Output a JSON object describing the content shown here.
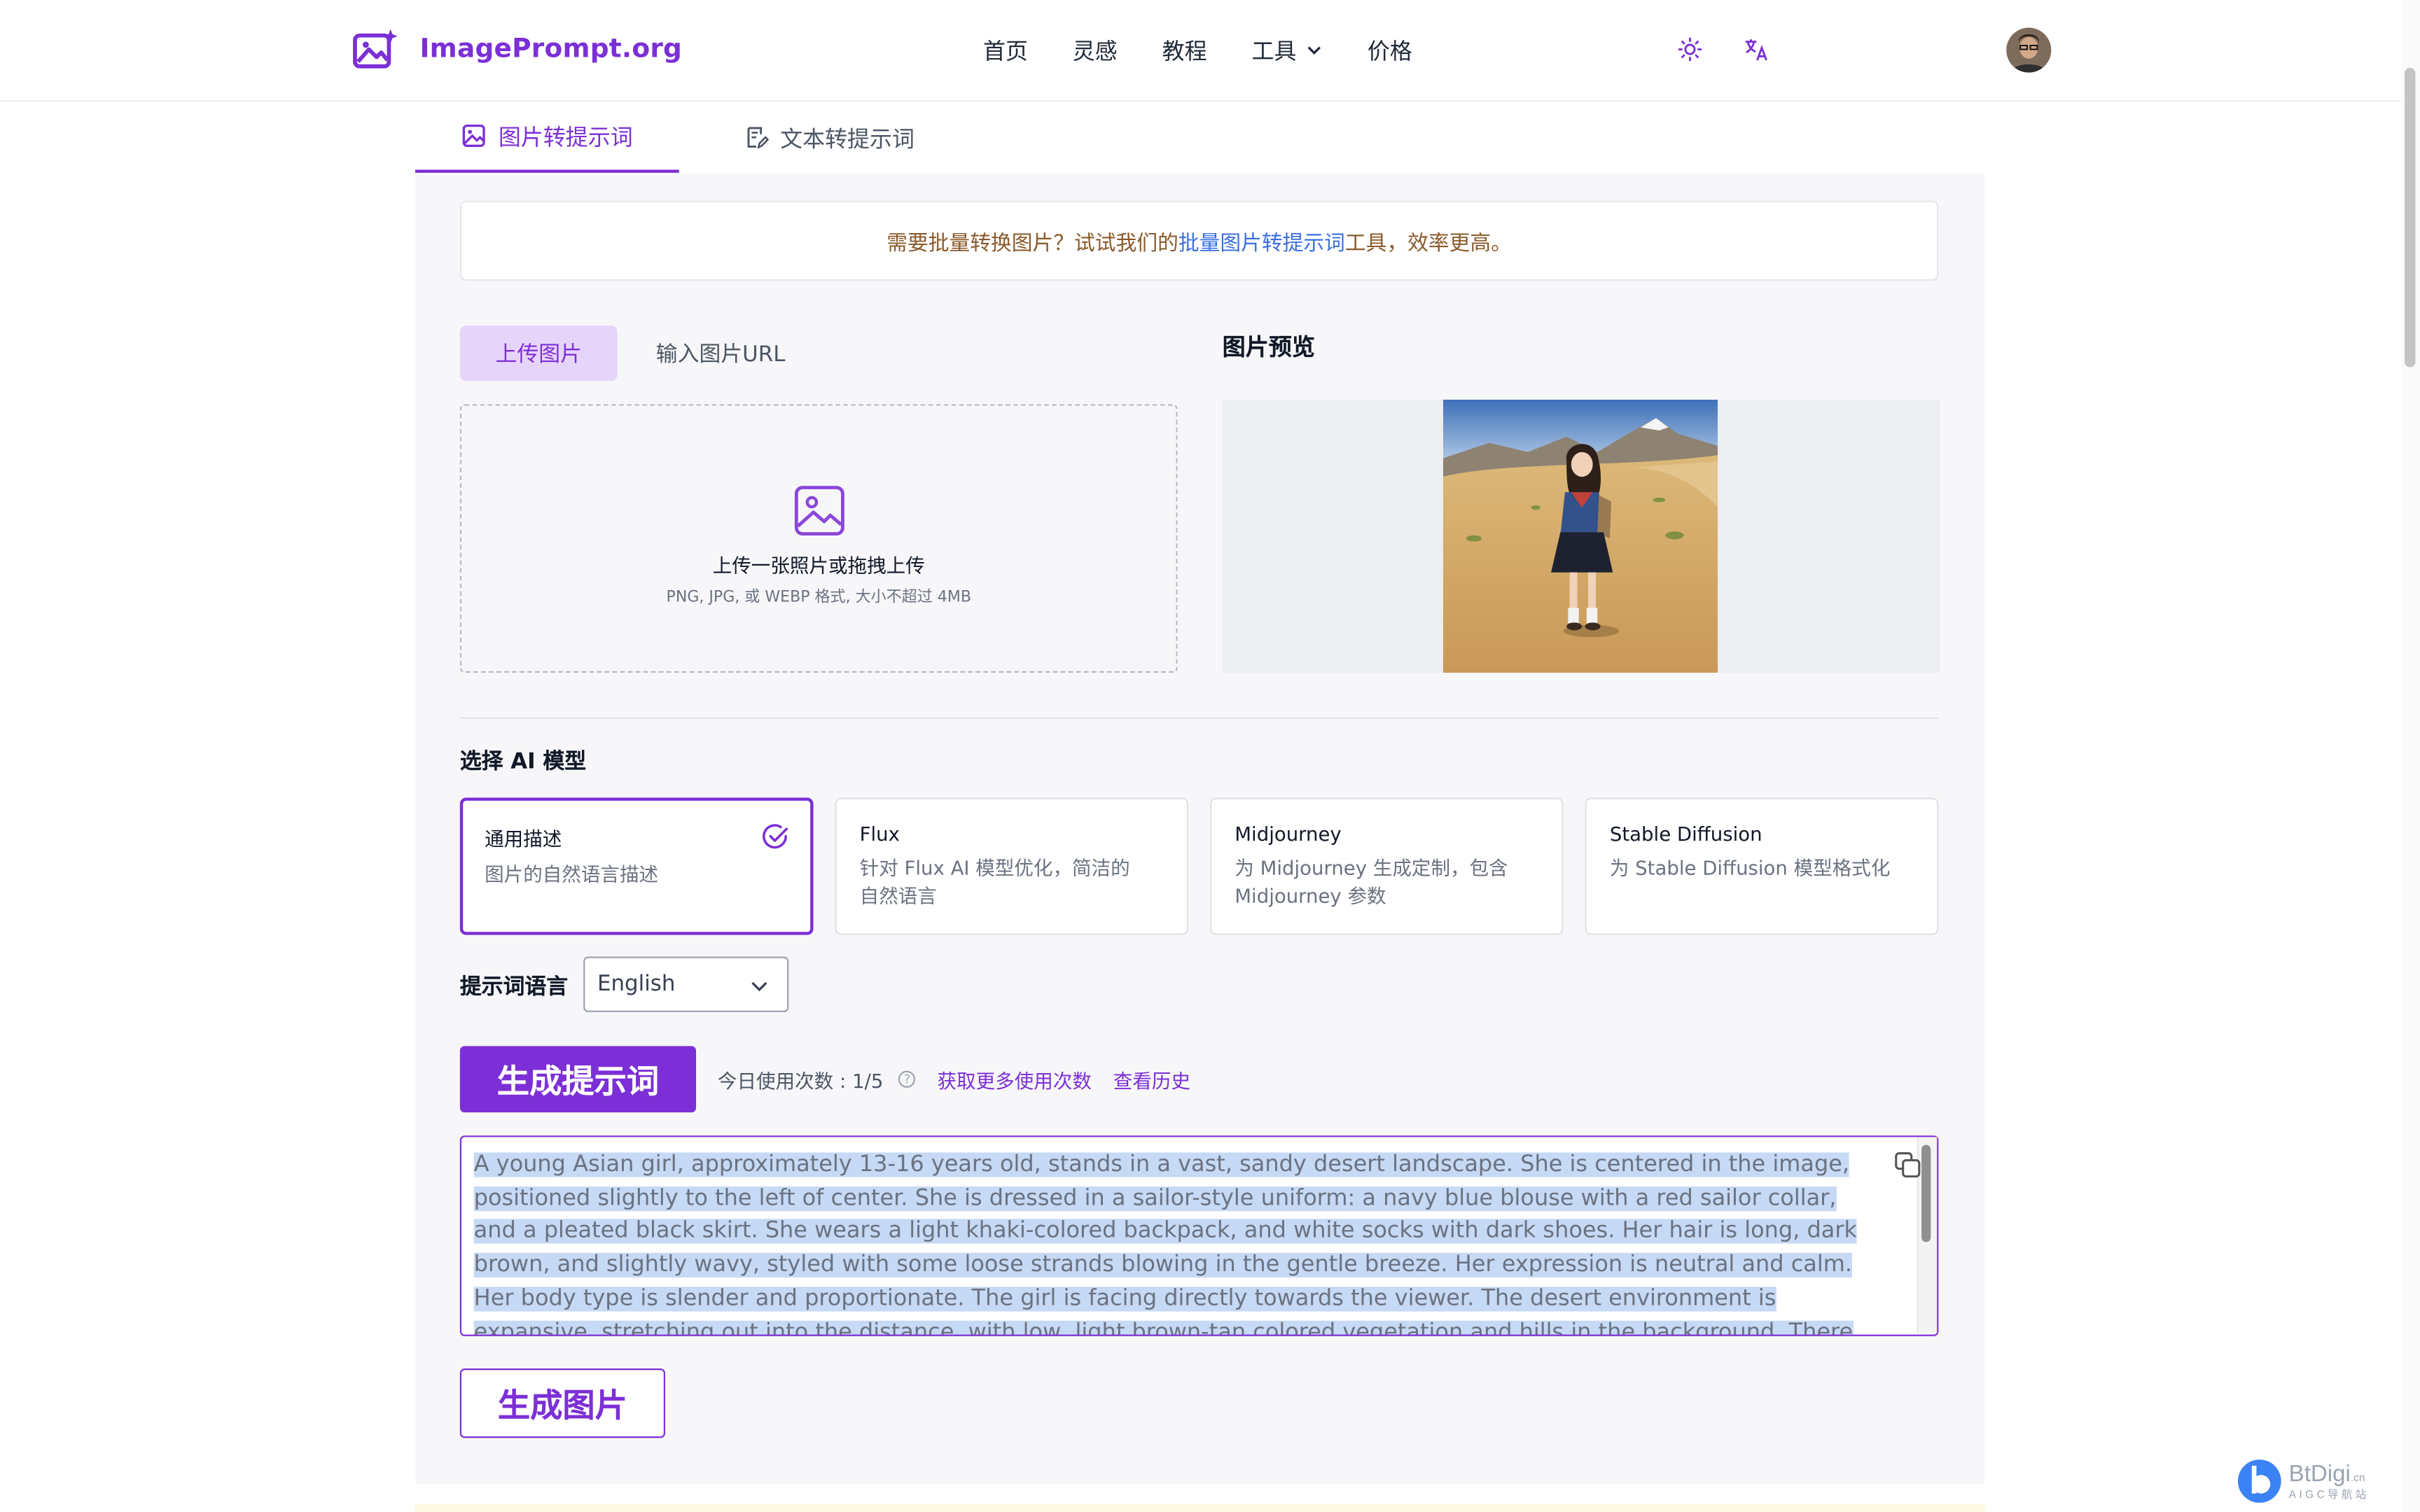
{
  "app": {
    "name": "ImagePrompt.org",
    "brand_color": "#7c2fd6"
  },
  "nav": {
    "home": "首页",
    "inspiration": "灵感",
    "tutorial": "教程",
    "tools": "工具",
    "pricing": "价格"
  },
  "header_icons": [
    "sun-icon",
    "translate-icon"
  ],
  "tabs": {
    "image_to_prompt": "图片转提示词",
    "text_to_prompt": "文本转提示词"
  },
  "notice": {
    "prefix": "需要批量转换图片？试试我们的",
    "link": "批量图片转提示词",
    "suffix": "工具，效率更高。"
  },
  "upload": {
    "tab_upload": "上传图片",
    "tab_url": "输入图片URL",
    "drop_title": "上传一张照片或拖拽上传",
    "drop_hint": "PNG, JPG, 或 WEBP 格式, 大小不超过 4MB"
  },
  "preview": {
    "title": "图片预览"
  },
  "models": {
    "title": "选择 AI 模型",
    "items": [
      {
        "name": "通用描述",
        "desc": "图片的自然语言描述",
        "selected": true
      },
      {
        "name": "Flux",
        "desc": "针对 Flux AI 模型优化，简洁的自然语言",
        "selected": false
      },
      {
        "name": "Midjourney",
        "desc": "为 Midjourney 生成定制，包含 Midjourney 参数",
        "selected": false
      },
      {
        "name": "Stable Diffusion",
        "desc": "为 Stable Diffusion 模型格式化",
        "selected": false
      }
    ]
  },
  "language": {
    "label": "提示词语言",
    "value": "English"
  },
  "actions": {
    "generate_prompt": "生成提示词",
    "usage_label": "今日使用次数 : 1/5",
    "help_glyph": "?",
    "more_usage": "获取更多使用次数",
    "history": "查看历史",
    "generate_image": "生成图片"
  },
  "output": {
    "text": "A young Asian girl, approximately 13-16 years old, stands in a vast, sandy desert landscape. She is centered in the image, positioned slightly to the left of center. She is dressed in a sailor-style uniform: a navy blue blouse with a red sailor collar, and a pleated black skirt. She wears a light khaki-colored backpack, and white socks with dark shoes. Her hair is long, dark brown, and slightly wavy, styled with some loose strands blowing in the gentle breeze. Her expression is neutral and calm. Her body type is slender and proportionate. The girl is facing directly towards the viewer. The desert environment is expansive, stretching out into the distance, with low, light brown-tan colored vegetation and hills in the background. There is a snow-capped mountain peak in the horizon, and the sky is a"
  },
  "watermark": {
    "name": "BtDigi",
    "suffix": ".cn",
    "tagline": "AIGC导航站"
  }
}
